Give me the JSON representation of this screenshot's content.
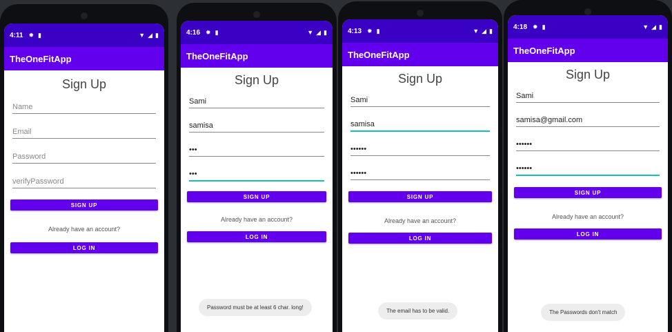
{
  "app_title": "TheOneFitApp",
  "heading": "Sign Up",
  "signup_label": "SIGN UP",
  "login_label": "LOG IN",
  "already_text": "Already have an account?",
  "colors": {
    "status_bar": "#3a00c4",
    "app_bar": "#6200ee",
    "button": "#6200ee",
    "focus_underline": "#18c0b0"
  },
  "icons": {
    "settings": "gear-icon",
    "sd_card": "sd-card-icon",
    "wifi": "wifi-icon",
    "signal": "signal-icon",
    "battery": "battery-icon"
  },
  "phones": [
    {
      "time": "4:11",
      "fields": {
        "name": "Name",
        "email": "Email",
        "password": "Password",
        "verify": "verifyPassword"
      },
      "toast": ""
    },
    {
      "time": "4:16",
      "fields": {
        "name": "Sami",
        "email": "samisa",
        "password": "•••",
        "verify": "•••"
      },
      "toast": "Password must be at least 6 char. long!"
    },
    {
      "time": "4:13",
      "fields": {
        "name": "Sami",
        "email": "samisa",
        "password": "••••••",
        "verify": "••••••"
      },
      "toast": "The email has to be valid."
    },
    {
      "time": "4:18",
      "fields": {
        "name": "Sami",
        "email": "samisa@gmail.com",
        "password": "••••••",
        "verify": "••••••"
      },
      "toast": "The Passwords don't match"
    }
  ]
}
